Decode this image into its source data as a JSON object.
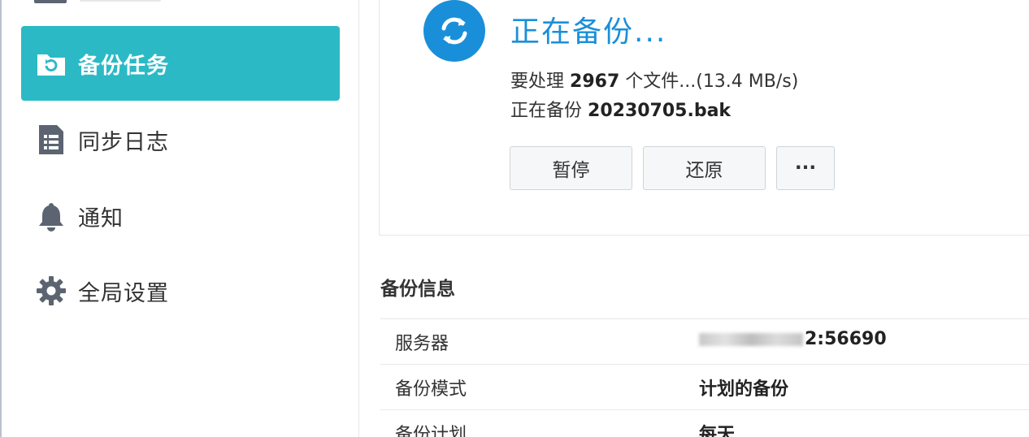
{
  "sidebar": {
    "items": [
      {
        "label": "备份任务",
        "icon": "backup-folder-icon",
        "active": true
      },
      {
        "label": "同步日志",
        "icon": "log-list-icon",
        "active": false
      },
      {
        "label": "通知",
        "icon": "bell-icon",
        "active": false
      },
      {
        "label": "全局设置",
        "icon": "gear-icon",
        "active": false
      }
    ]
  },
  "status": {
    "title": "正在备份...",
    "processing_prefix": "要处理",
    "file_count": "2967",
    "processing_suffix": "个文件...(13.4 MB/s)",
    "current_prefix": "正在备份",
    "current_file": "20230705.bak",
    "icon": "sync-icon"
  },
  "actions": {
    "pause_label": "暂停",
    "restore_label": "还原",
    "more_label": "···"
  },
  "info": {
    "section_title": "备份信息",
    "rows": [
      {
        "label": "服务器",
        "value": "2:56690"
      },
      {
        "label": "备份模式",
        "value": "计划的备份"
      },
      {
        "label": "备份计划",
        "value": "每天"
      }
    ]
  },
  "colors": {
    "accent": "#2bbac5",
    "status_blue": "#1a8fd9"
  }
}
